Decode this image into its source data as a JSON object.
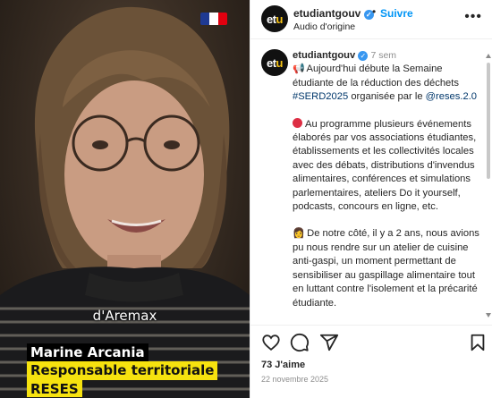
{
  "video": {
    "caption": "d'Aremax",
    "person_name": "Marine Arcania",
    "person_role": "Responsable territoriale",
    "organization": "RESES",
    "flag_colors": [
      "#1f3a93",
      "#ffffff",
      "#e1000f"
    ]
  },
  "header": {
    "logo_text": "etu",
    "username": "etudiantgouv",
    "separator": "•",
    "follow_label": "Suivre",
    "audio_label": "Audio d'origine",
    "more_icon": "more-horizontal-icon"
  },
  "post": {
    "username": "etudiantgouv",
    "time": "7 sem",
    "p1_intro": "Aujourd'hui débute la Semaine étudiante de la réduction des déchets",
    "p1_hashtag": "#SERD2025",
    "p1_mid": "organisée par le",
    "p1_mention": "@reses.2.0",
    "p2": "Au programme plusieurs événements élaborés par vos associations étudiantes, établissements et les collectivités locales avec des débats, distributions d'invendus alimentaires, conférences et simulations parlementaires, ateliers Do it yourself, podcasts, concours en ligne, etc.",
    "p3": "De notre côté, il y a 2 ans, nous avions pu nous rendre sur un atelier de cuisine anti-gaspi, un moment permettant de sensibiliser au gaspillage alimentaire tout en luttant contre l'isolement et la précarité étudiante."
  },
  "actions": {
    "likes": "73 J'aime",
    "date": "22 novembre 2025",
    "icons": [
      "heart-icon",
      "comment-icon",
      "share-icon",
      "bookmark-icon"
    ]
  },
  "colors": {
    "link": "#00376b",
    "follow": "#0095f6",
    "highlight_yellow": "#f6e20f",
    "verified": "#3897f0"
  }
}
